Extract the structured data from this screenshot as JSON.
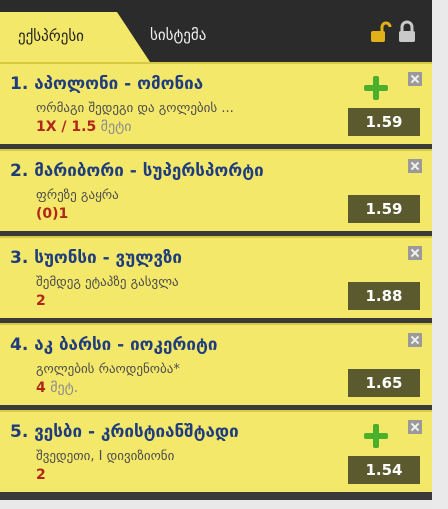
{
  "tabs": {
    "active": "ექსპრესი",
    "other": "სისტემა"
  },
  "icons": {
    "unlock": "unlock-icon",
    "lock": "lock-icon",
    "add": "plus-icon",
    "close": "close-icon"
  },
  "bets": [
    {
      "title": "1. აპოლონი - ომონია",
      "market": "ორმაგი შედეგი და გოლების ...",
      "pick": "1X / 1.5",
      "pick_extra": " მეტი",
      "odds": "1.59",
      "has_plus": true
    },
    {
      "title": "2. მარიბორი - სუპერსპორტი",
      "market": "ფრეზე გაყრა",
      "pick": "(0)1",
      "pick_extra": "",
      "odds": "1.59",
      "has_plus": false
    },
    {
      "title": "3. სუონსი - ვულვზი",
      "market": "შემდეგ ეტაპზე გასვლა",
      "pick": "2",
      "pick_extra": "",
      "odds": "1.88",
      "has_plus": false
    },
    {
      "title": "4. აკ ბარსი - იოკერიტი",
      "market": "გოლების რაოდენობა*",
      "pick": "4",
      "pick_extra": " მეტ.",
      "odds": "1.65",
      "has_plus": false
    },
    {
      "title": "5. ვესბი - კრისტიანშტადი",
      "market": "შვედეთი, I დივიზიონი",
      "pick": "2",
      "pick_extra": "",
      "odds": "1.54",
      "has_plus": true
    }
  ],
  "colors": {
    "panel_bg": "#f3e86a",
    "title": "#1f3c7d",
    "pick": "#b0261a",
    "odds_bg": "#5a5a2e",
    "plus": "#48b02a"
  }
}
